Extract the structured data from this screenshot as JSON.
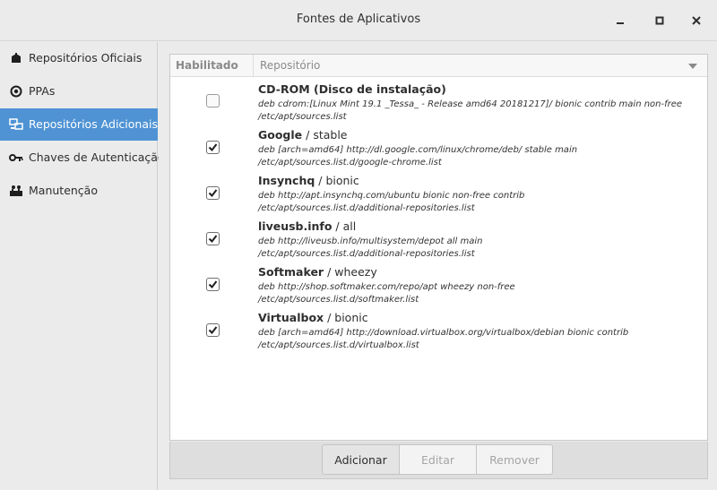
{
  "window": {
    "title": "Fontes de Aplicativos"
  },
  "sidebar": {
    "items": [
      {
        "label": "Repositórios Oficiais",
        "icon": "package-icon",
        "active": false
      },
      {
        "label": "PPAs",
        "icon": "ppa-icon",
        "active": false
      },
      {
        "label": "Repositórios Adicionais",
        "icon": "network-icon",
        "active": true
      },
      {
        "label": "Chaves de Autenticação",
        "icon": "key-icon",
        "active": false
      },
      {
        "label": "Manutenção",
        "icon": "tools-icon",
        "active": false
      }
    ]
  },
  "table": {
    "headers": {
      "enabled": "Habilitado",
      "repository": "Repositório"
    },
    "rows": [
      {
        "enabled": false,
        "name": "CD-ROM (Disco de instalação)",
        "suffix": "",
        "line1": "deb cdrom:[Linux Mint 19.1 _Tessa_ - Release amd64 20181217]/ bionic contrib main non-free",
        "line2": "/etc/apt/sources.list"
      },
      {
        "enabled": true,
        "name": "Google",
        "suffix": " / stable",
        "line1": "deb [arch=amd64] http://dl.google.com/linux/chrome/deb/ stable main",
        "line2": "/etc/apt/sources.list.d/google-chrome.list"
      },
      {
        "enabled": true,
        "name": "Insynchq",
        "suffix": " / bionic",
        "line1": "deb http://apt.insynchq.com/ubuntu bionic non-free contrib",
        "line2": "/etc/apt/sources.list.d/additional-repositories.list"
      },
      {
        "enabled": true,
        "name": "liveusb.info",
        "suffix": " / all",
        "line1": "deb http://liveusb.info/multisystem/depot all main",
        "line2": "/etc/apt/sources.list.d/additional-repositories.list"
      },
      {
        "enabled": true,
        "name": "Softmaker",
        "suffix": " / wheezy",
        "line1": "deb http://shop.softmaker.com/repo/apt wheezy non-free",
        "line2": "/etc/apt/sources.list.d/softmaker.list"
      },
      {
        "enabled": true,
        "name": "Virtualbox",
        "suffix": " / bionic",
        "line1": "deb [arch=amd64] http://download.virtualbox.org/virtualbox/debian bionic contrib",
        "line2": "/etc/apt/sources.list.d/virtualbox.list"
      }
    ]
  },
  "buttons": {
    "add": "Adicionar",
    "edit": "Editar",
    "remove": "Remover"
  },
  "colors": {
    "accent": "#4f93d4"
  }
}
